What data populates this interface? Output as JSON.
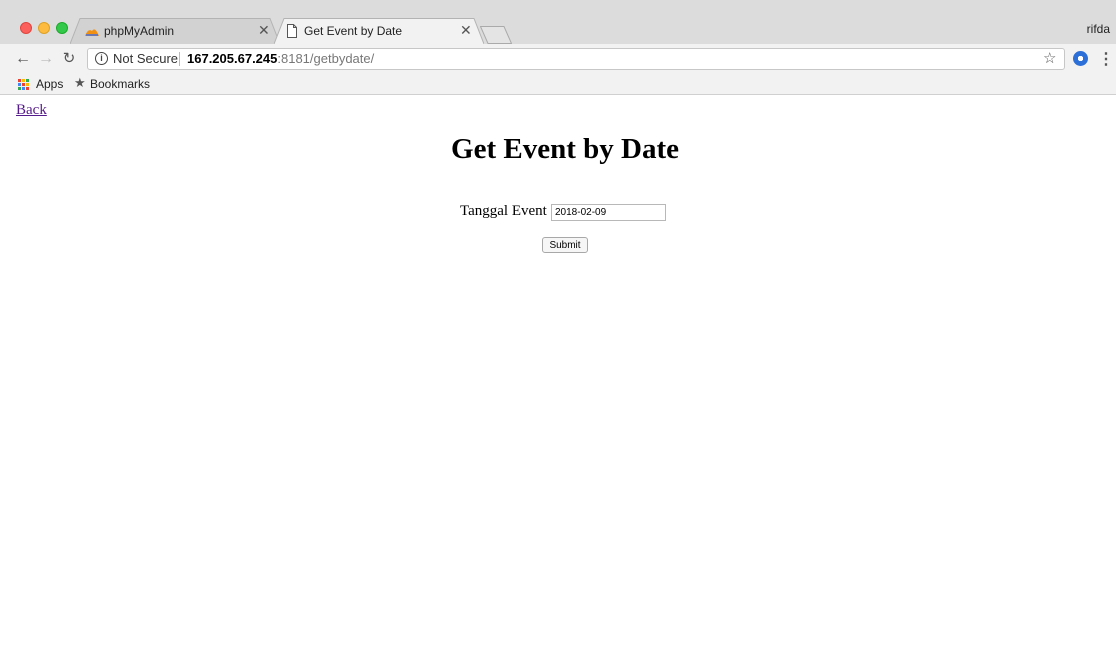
{
  "browser": {
    "tabs": [
      {
        "title": "phpMyAdmin",
        "icon": "phpmyadmin-icon",
        "active": false
      },
      {
        "title": "Get Event by Date",
        "icon": "document-icon",
        "active": true
      }
    ],
    "profile_name": "rifda",
    "security_label": "Not Secure",
    "url_host": "167.205.67.245",
    "url_rest": ":8181/getbydate/",
    "bookmarks": {
      "apps_label": "Apps",
      "bookmarks_label": "Bookmarks"
    }
  },
  "page": {
    "back_link": "Back",
    "title": "Get Event by Date",
    "field_label": "Tanggal Event :",
    "date_value": "2018-02-09",
    "submit_label": "Submit"
  }
}
